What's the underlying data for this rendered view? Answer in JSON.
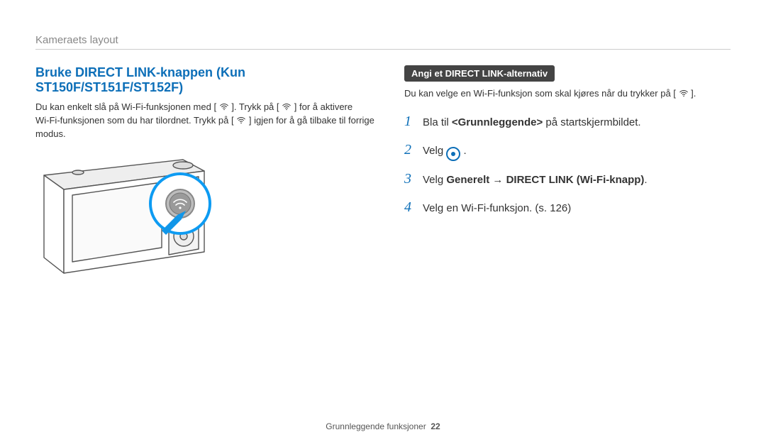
{
  "header": {
    "breadcrumb": "Kameraets layout"
  },
  "left": {
    "heading": "Bruke DIRECT LINK-knappen (Kun ST150F/ST151F/ST152F)",
    "intro_a": "Du kan enkelt slå på Wi-Fi-funksjonen med [",
    "intro_b": "]. Trykk på [",
    "intro_c": "] for å aktivere Wi‑Fi‑funksjonen som du har tilordnet. Trykk på [",
    "intro_d": "] igjen for å gå tilbake til forrige modus."
  },
  "right": {
    "pill": "Angi et DIRECT LINK-alternativ",
    "intro_a": "Du kan velge en Wi-Fi-funksjon som skal kjøres når du trykker på [",
    "intro_b": "].",
    "steps": {
      "s1_a": "Bla til ",
      "s1_b": "<Grunnleggende>",
      "s1_c": " på startskjermbildet.",
      "s2_a": "Velg ",
      "s2_b": ".",
      "s3_a": "Velg ",
      "s3_b": "Generelt",
      "s3_arrow": " → ",
      "s3_c": "DIRECT LINK (Wi-Fi-knapp)",
      "s3_d": ".",
      "s4": "Velg en Wi-Fi-funksjon. (s. 126)"
    }
  },
  "footer": {
    "section": "Grunnleggende funksjoner",
    "page": "22"
  },
  "icons": {
    "wifi": "wifi-icon"
  }
}
